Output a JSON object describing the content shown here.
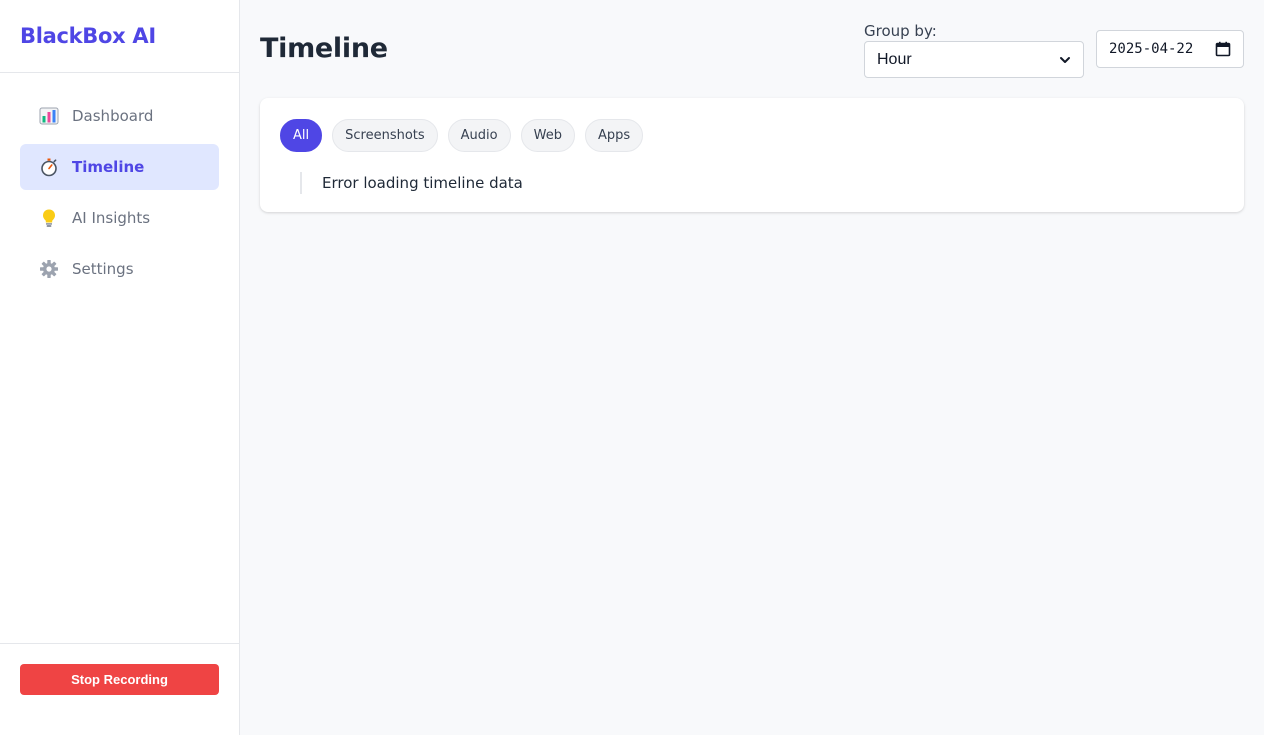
{
  "sidebar": {
    "brand": "BlackBox AI",
    "items": [
      {
        "label": "Dashboard",
        "icon": "bar-chart-icon",
        "active": false
      },
      {
        "label": "Timeline",
        "icon": "stopwatch-icon",
        "active": true
      },
      {
        "label": "AI Insights",
        "icon": "lightbulb-icon",
        "active": false
      },
      {
        "label": "Settings",
        "icon": "gear-icon",
        "active": false
      }
    ],
    "stop_button": "Stop Recording"
  },
  "main": {
    "title": "Timeline",
    "group_by": {
      "label": "Group by:",
      "selected": "Hour"
    },
    "date_value": "2025-04-22",
    "filters": [
      {
        "label": "All",
        "active": true
      },
      {
        "label": "Screenshots",
        "active": false
      },
      {
        "label": "Audio",
        "active": false
      },
      {
        "label": "Web",
        "active": false
      },
      {
        "label": "Apps",
        "active": false
      }
    ],
    "message": "Error loading timeline data"
  },
  "colors": {
    "accent": "#4f46e5",
    "danger": "#ef4444",
    "active_bg": "#e0e7ff"
  }
}
